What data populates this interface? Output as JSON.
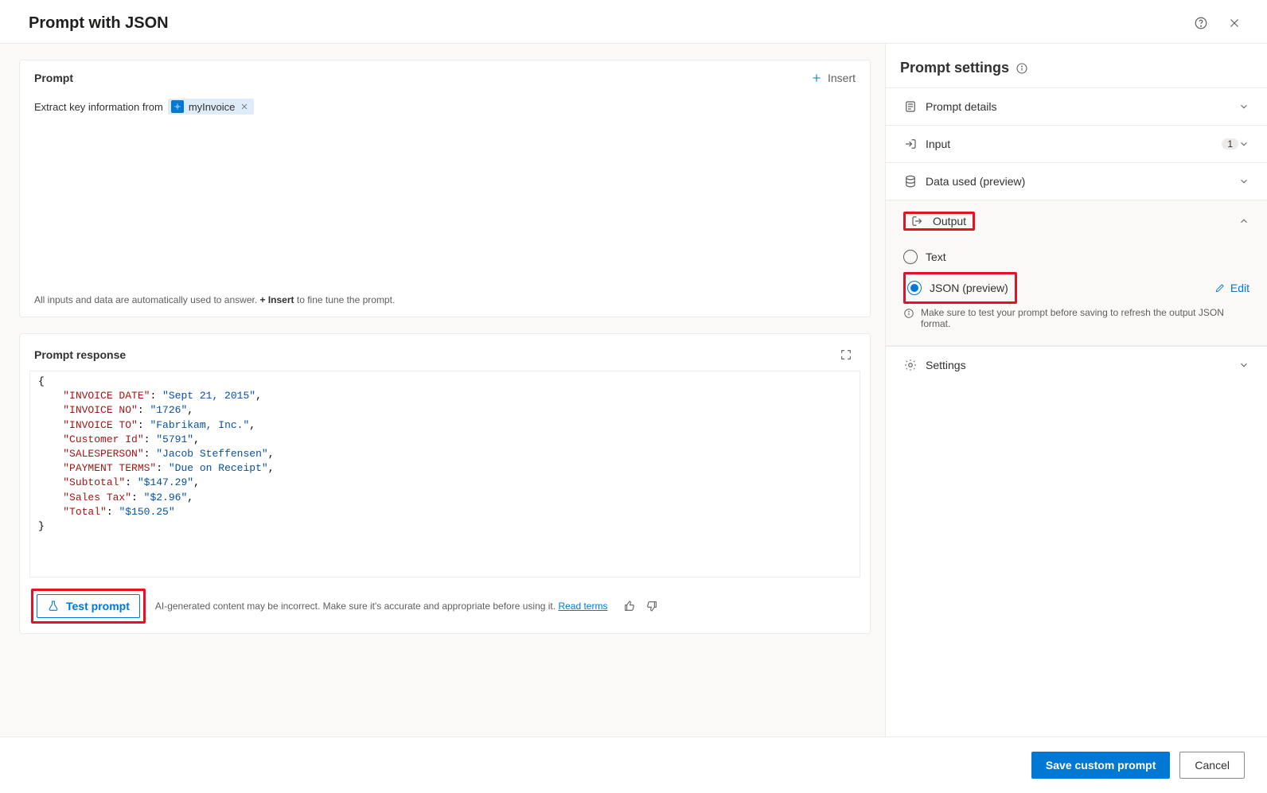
{
  "header": {
    "title": "Prompt with JSON"
  },
  "prompt": {
    "card_title": "Prompt",
    "insert_label": "Insert",
    "text_before": "Extract key information from",
    "chip_label": "myInvoice",
    "hint_pre": "All inputs and data are automatically used to answer. ",
    "hint_bold": "+ Insert",
    "hint_post": " to fine tune the prompt."
  },
  "response": {
    "card_title": "Prompt response",
    "json_pairs": [
      {
        "k": "INVOICE DATE",
        "v": "Sept 21, 2015"
      },
      {
        "k": "INVOICE NO",
        "v": "1726"
      },
      {
        "k": "INVOICE TO",
        "v": "Fabrikam, Inc."
      },
      {
        "k": "Customer Id",
        "v": "5791"
      },
      {
        "k": "SALESPERSON",
        "v": "Jacob Steffensen"
      },
      {
        "k": "PAYMENT TERMS",
        "v": "Due on Receipt"
      },
      {
        "k": "Subtotal",
        "v": "$147.29"
      },
      {
        "k": "Sales Tax",
        "v": "$2.96"
      },
      {
        "k": "Total",
        "v": "$150.25"
      }
    ],
    "test_label": "Test prompt",
    "disclaimer": "AI-generated content may be incorrect. Make sure it's accurate and appropriate before using it.",
    "terms_label": "Read terms"
  },
  "rail": {
    "title": "Prompt settings",
    "items": {
      "details": "Prompt details",
      "input": "Input",
      "input_badge": "1",
      "data": "Data used (preview)",
      "output": "Output",
      "settings": "Settings"
    },
    "output": {
      "text_label": "Text",
      "json_label": "JSON (preview)",
      "edit_label": "Edit",
      "hint": "Make sure to test your prompt before saving to refresh the output JSON format."
    }
  },
  "footer": {
    "save": "Save custom prompt",
    "cancel": "Cancel"
  }
}
